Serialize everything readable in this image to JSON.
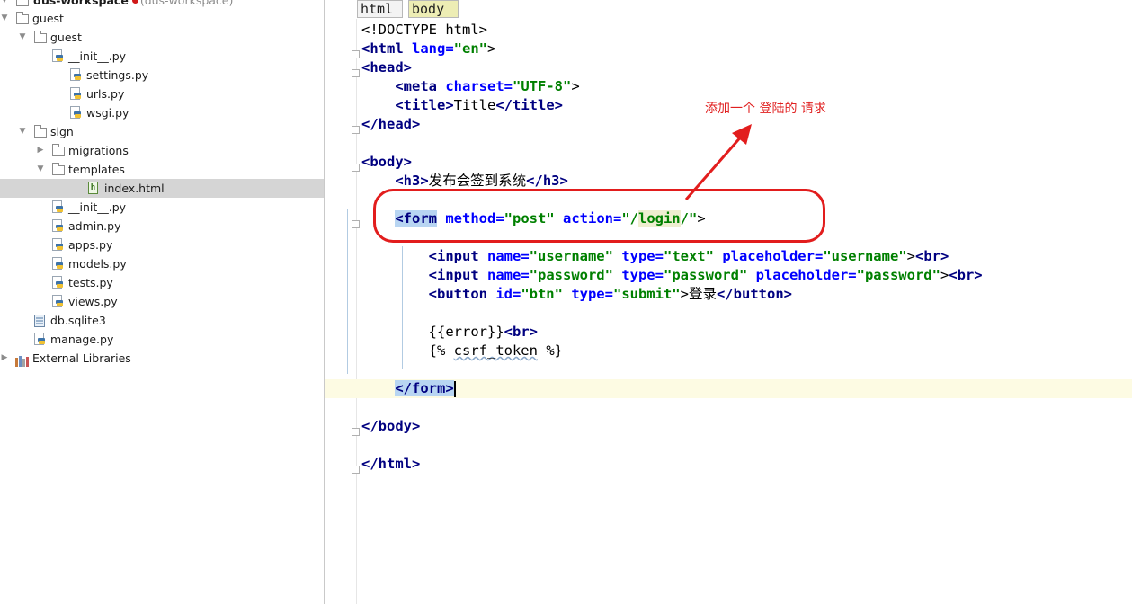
{
  "project_tree": {
    "root": {
      "label": "dus-workspace",
      "note": "(dus-workspace)"
    },
    "items": [
      {
        "label": "guest",
        "type": "folder",
        "arrow": "▼"
      },
      {
        "label": "guest",
        "type": "folder",
        "arrow": "▼"
      },
      {
        "label": "__init__.py",
        "type": "py"
      },
      {
        "label": "settings.py",
        "type": "py"
      },
      {
        "label": "urls.py",
        "type": "py"
      },
      {
        "label": "wsgi.py",
        "type": "py"
      },
      {
        "label": "sign",
        "type": "folder",
        "arrow": "▼"
      },
      {
        "label": "migrations",
        "type": "folder",
        "arrow": "▶"
      },
      {
        "label": "templates",
        "type": "folder",
        "arrow": "▼"
      },
      {
        "label": "index.html",
        "type": "html",
        "selected": true
      },
      {
        "label": "__init__.py",
        "type": "py"
      },
      {
        "label": "admin.py",
        "type": "py"
      },
      {
        "label": "apps.py",
        "type": "py"
      },
      {
        "label": "models.py",
        "type": "py"
      },
      {
        "label": "tests.py",
        "type": "py"
      },
      {
        "label": "views.py",
        "type": "py"
      },
      {
        "label": "db.sqlite3",
        "type": "db"
      },
      {
        "label": "manage.py",
        "type": "py"
      },
      {
        "label": "External Libraries",
        "type": "lib",
        "arrow": "▶"
      }
    ]
  },
  "breadcrumb": {
    "first": "html",
    "second": "body"
  },
  "code": {
    "doctype": "<!DOCTYPE html>",
    "t_html_open": "<html",
    "a_lang": " lang=",
    "v_en": "\"en\"",
    "gt": ">",
    "t_head_open": "<head>",
    "t_meta": "<meta",
    "a_charset": " charset=",
    "v_utf8": "\"UTF-8\"",
    "t_title_open": "<title>",
    "title_text": "Title",
    "t_title_close": "</title>",
    "t_head_close": "</head>",
    "t_body_open": "<body>",
    "t_h3_open": "<h3>",
    "h3_text": "发布会签到系统",
    "t_h3_close": "</h3>",
    "t_form": "<form",
    "a_method": " method=",
    "v_post": "\"post\"",
    "a_action": " action=",
    "v_action_q": "\"/",
    "v_login": "login",
    "v_action_end": "/\"",
    "t_input": "<input",
    "a_name": " name=",
    "v_username": "\"username\"",
    "a_type": " type=",
    "v_text": "\"text\"",
    "a_placeholder": " placeholder=",
    "v_password": "\"password\"",
    "t_br": "<br>",
    "t_button": "<button",
    "a_id": " id=",
    "v_btn": "\"btn\"",
    "v_submit": "\"submit\"",
    "button_text": "登录",
    "t_button_close": "</button>",
    "error_expr": "{{error}}",
    "csrf_open": "{% ",
    "csrf_word": "csrf_token",
    "csrf_close": " %}",
    "t_form_close": "</form>",
    "t_body_close": "</body>",
    "t_html_close": "</html>"
  },
  "annotation": {
    "text": "添加一个 登陆的 请求",
    "color": "#e02020"
  }
}
